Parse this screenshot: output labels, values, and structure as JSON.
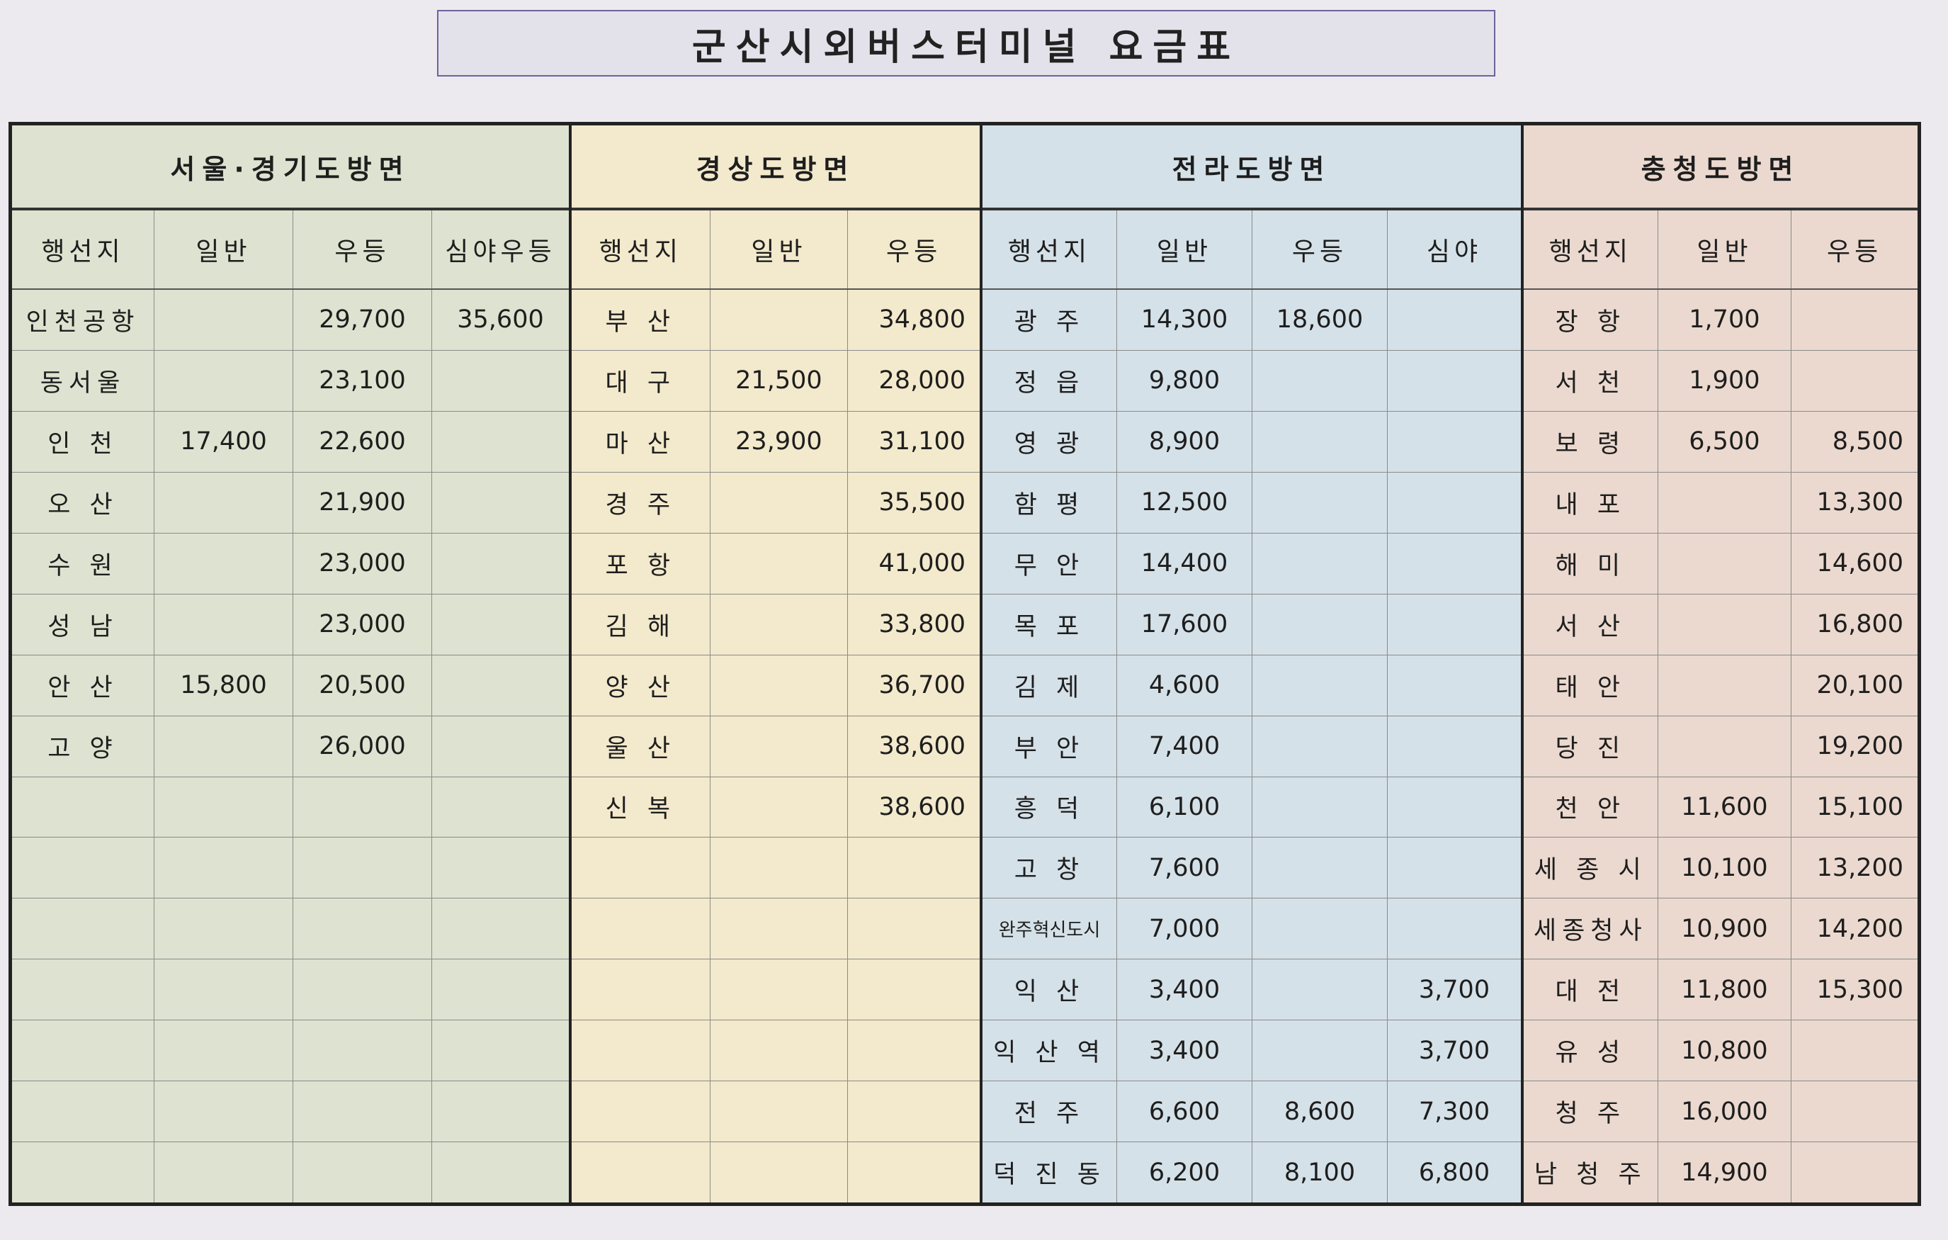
{
  "title": "군산시외버스터미널 요금표",
  "sections": [
    {
      "title": "서울·경기도방면",
      "bg": "#dde3d0",
      "columns": [
        "행선지",
        "일반",
        "우등",
        "심야우등"
      ],
      "rows": [
        [
          "인천공항",
          "",
          "29,700",
          "35,600"
        ],
        [
          "동서울",
          "",
          "23,100",
          ""
        ],
        [
          "인 천",
          "17,400",
          "22,600",
          ""
        ],
        [
          "오 산",
          "",
          "21,900",
          ""
        ],
        [
          "수 원",
          "",
          "23,000",
          ""
        ],
        [
          "성 남",
          "",
          "23,000",
          ""
        ],
        [
          "안 산",
          "15,800",
          "20,500",
          ""
        ],
        [
          "고 양",
          "",
          "26,000",
          ""
        ],
        [
          "",
          "",
          "",
          ""
        ],
        [
          "",
          "",
          "",
          ""
        ],
        [
          "",
          "",
          "",
          ""
        ],
        [
          "",
          "",
          "",
          ""
        ],
        [
          "",
          "",
          "",
          ""
        ],
        [
          "",
          "",
          "",
          ""
        ],
        [
          "",
          "",
          "",
          ""
        ]
      ]
    },
    {
      "title": "경상도방면",
      "bg": "#f3e9cc",
      "columns": [
        "행선지",
        "일반",
        "우등"
      ],
      "rows": [
        [
          "부 산",
          "",
          "34,800"
        ],
        [
          "대 구",
          "21,500",
          "28,000"
        ],
        [
          "마 산",
          "23,900",
          "31,100"
        ],
        [
          "경 주",
          "",
          "35,500"
        ],
        [
          "포 항",
          "",
          "41,000"
        ],
        [
          "김 해",
          "",
          "33,800"
        ],
        [
          "양 산",
          "",
          "36,700"
        ],
        [
          "울 산",
          "",
          "38,600"
        ],
        [
          "신 복",
          "",
          "38,600"
        ],
        [
          "",
          "",
          ""
        ],
        [
          "",
          "",
          ""
        ],
        [
          "",
          "",
          ""
        ],
        [
          "",
          "",
          ""
        ],
        [
          "",
          "",
          ""
        ],
        [
          "",
          "",
          ""
        ]
      ]
    },
    {
      "title": "전라도방면",
      "bg": "#d5e1e8",
      "columns": [
        "행선지",
        "일반",
        "우등",
        "심야"
      ],
      "rows": [
        [
          "광 주",
          "14,300",
          "18,600",
          ""
        ],
        [
          "정 읍",
          "9,800",
          "",
          ""
        ],
        [
          "영 광",
          "8,900",
          "",
          ""
        ],
        [
          "함 평",
          "12,500",
          "",
          ""
        ],
        [
          "무 안",
          "14,400",
          "",
          ""
        ],
        [
          "목 포",
          "17,600",
          "",
          ""
        ],
        [
          "김 제",
          "4,600",
          "",
          ""
        ],
        [
          "부 안",
          "7,400",
          "",
          ""
        ],
        [
          "흥 덕",
          "6,100",
          "",
          ""
        ],
        [
          "고 창",
          "7,600",
          "",
          ""
        ],
        [
          "완주혁신도시",
          "7,000",
          "",
          ""
        ],
        [
          "익 산",
          "3,400",
          "",
          "3,700"
        ],
        [
          "익 산 역",
          "3,400",
          "",
          "3,700"
        ],
        [
          "전 주",
          "6,600",
          "8,600",
          "7,300"
        ],
        [
          "덕 진 동",
          "6,200",
          "8,100",
          "6,800"
        ]
      ]
    },
    {
      "title": "충청도방면",
      "bg": "#ebd9cf",
      "columns": [
        "행선지",
        "일반",
        "우등"
      ],
      "rows": [
        [
          "장 항",
          "1,700",
          ""
        ],
        [
          "서 천",
          "1,900",
          ""
        ],
        [
          "보 령",
          "6,500",
          "8,500"
        ],
        [
          "내 포",
          "",
          "13,300"
        ],
        [
          "해 미",
          "",
          "14,600"
        ],
        [
          "서 산",
          "",
          "16,800"
        ],
        [
          "태 안",
          "",
          "20,100"
        ],
        [
          "당 진",
          "",
          "19,200"
        ],
        [
          "천 안",
          "11,600",
          "15,100"
        ],
        [
          "세 종 시",
          "10,100",
          "13,200"
        ],
        [
          "세종청사",
          "10,900",
          "14,200"
        ],
        [
          "대 전",
          "11,800",
          "15,300"
        ],
        [
          "유 성",
          "10,800",
          ""
        ],
        [
          "청 주",
          "16,000",
          ""
        ],
        [
          "남 청 주",
          "14,900",
          ""
        ]
      ]
    }
  ]
}
